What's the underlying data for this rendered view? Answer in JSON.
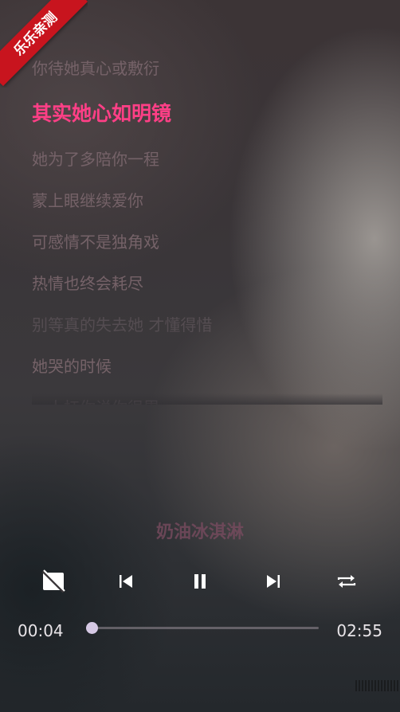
{
  "badge": {
    "text": "乐乐亲测"
  },
  "lyrics": {
    "lines": [
      {
        "text": "你待她真心或敷衍",
        "state": "past"
      },
      {
        "text": "其实她心如明镜",
        "state": "current"
      },
      {
        "text": "她为了多陪你一程",
        "state": "upcoming"
      },
      {
        "text": "蒙上眼继续爱你",
        "state": "upcoming"
      },
      {
        "text": "可感情不是独角戏",
        "state": "upcoming"
      },
      {
        "text": "热情也终会耗尽",
        "state": "upcoming"
      },
      {
        "text": "别等真的失去她 才懂得惜",
        "state": "upcoming"
      },
      {
        "text": "她哭的时候",
        "state": "upcoming"
      },
      {
        "text": "一人扛你说你很累",
        "state": "partial"
      }
    ],
    "current_color": "#ff3f86"
  },
  "song": {
    "title": "奶油冰淇淋"
  },
  "controls": {
    "icons": [
      "cover-off-icon",
      "skip-previous-icon",
      "pause-icon",
      "skip-next-icon",
      "repeat-icon"
    ]
  },
  "progress": {
    "current_time": "00:04",
    "total_time": "02:55",
    "fraction": 0.023,
    "color": "#d5c8e4"
  }
}
